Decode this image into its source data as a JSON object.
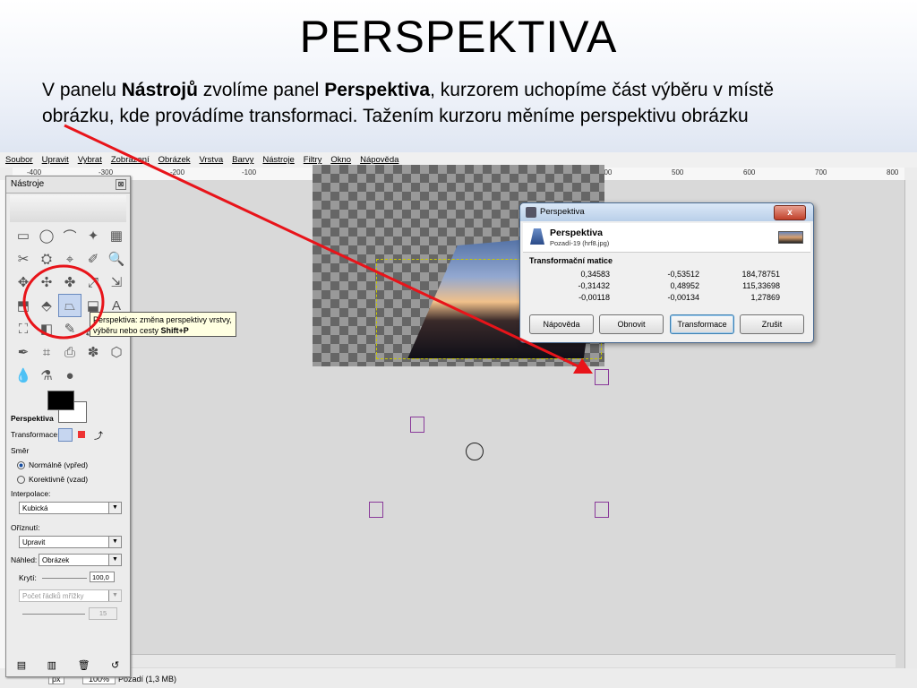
{
  "slide": {
    "title": "PERSPEKTIVA",
    "line1_a": "V panelu ",
    "line1_b": "Nástrojů",
    "line1_c": " zvolíme panel ",
    "line1_d": "Perspektiva",
    "line1_e": ", kurzorem uchopíme část výběru v místě",
    "line2": "obrázku, kde provádíme transformaci. Tažením kurzoru měníme perspektivu obrázku"
  },
  "menu": [
    "Soubor",
    "Upravit",
    "Vybrat",
    "Zobrazení",
    "Obrázek",
    "Vrstva",
    "Barvy",
    "Nástroje",
    "Filtry",
    "Okno",
    "Nápověda"
  ],
  "ruler": [
    "-400",
    "-300",
    "-200",
    "-100",
    "0",
    "100",
    "200",
    "300",
    "400",
    "500",
    "600",
    "700",
    "800"
  ],
  "toolbox": {
    "title": "Nástroje",
    "close": "⊠",
    "tools": [
      "▭",
      "◯",
      "⌒",
      "✦",
      "▦",
      "✂",
      "⛭",
      "⌖",
      "✐",
      "🔍",
      "✥",
      "✣",
      "✤",
      "⤢",
      "⇲",
      "⬒",
      "⬘",
      "⏢",
      "⬓",
      "A",
      "⛶",
      "◧",
      "✎",
      "🖌",
      "⌑",
      "✒",
      "⌗",
      "⎙",
      "✽",
      "⬡",
      "💧",
      "⚗",
      "●"
    ],
    "active_index": 17,
    "options_title": "Perspektiva",
    "transform_label": "Transformace:",
    "direction_label": "Směr",
    "dir_normal": "Normálně (vpřed)",
    "dir_corrective": "Korektivně (vzad)",
    "interp_label": "Interpolace:",
    "interp_value": "Kubická",
    "clip_label": "Oříznutí:",
    "clip_value": "Upravit",
    "preview_label": "Náhled:",
    "preview_value": "Obrázek",
    "opacity_label": "Krytí:",
    "opacity_value": "100,0",
    "grid_value": "Počet řádků mřížky",
    "grid_num": "15"
  },
  "tooltip": {
    "line1": "Perspektiva: změna perspektivy vrstvy,",
    "line2_a": "výběru nebo cesty  ",
    "shortcut": "Shift+P"
  },
  "dialog": {
    "title": "Perspektiva",
    "close": "x",
    "head_title": "Perspektiva",
    "head_sub": "Pozadí-19 (hrf8.jpg)",
    "matrix_title": "Transformační matice",
    "matrix": [
      [
        "0,34583",
        "-0,53512",
        "184,78751"
      ],
      [
        "-0,31432",
        "0,48952",
        "115,33698"
      ],
      [
        "-0,00118",
        "-0,00134",
        "1,27869"
      ]
    ],
    "btn_help": "Nápověda",
    "btn_reset": "Obnovit",
    "btn_transform": "Transformace",
    "btn_cancel": "Zrušit"
  },
  "status": {
    "unit": "px",
    "zoom": "100%",
    "info": "Pozadí (1,3 MB)"
  },
  "colors": {
    "arrow": "#e8141a",
    "circle": "#e8141a"
  }
}
